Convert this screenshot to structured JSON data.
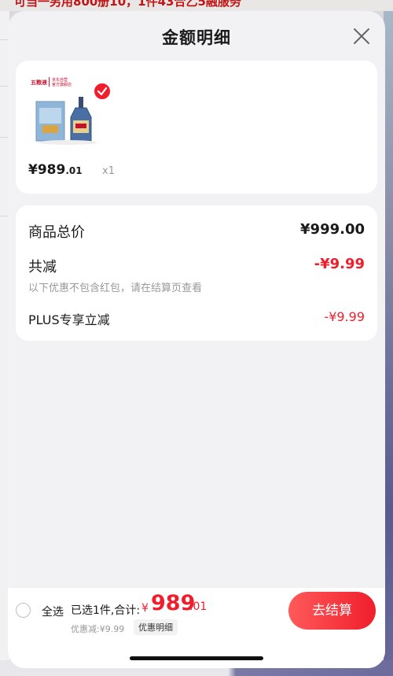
{
  "background": {
    "top_text": "可当一另用800册10，1件43合乙5融服务"
  },
  "sheet": {
    "title": "金额明细",
    "close_icon": "close-icon"
  },
  "product": {
    "store_badge": "京东自营 官方旗舰店",
    "price_int": "¥989",
    "price_cents": ".01",
    "quantity": "x1",
    "selected": true
  },
  "summary": {
    "total_label": "商品总价",
    "total_value": "¥999.00",
    "reduce_label": "共减",
    "reduce_value": "-¥9.99",
    "reduce_note": "以下优惠不包含红包，请在结算页查看",
    "plus_label": "PLUS专享立减",
    "plus_value": "-¥9.99"
  },
  "footer": {
    "select_all_label": "全选",
    "selected_text": "已选1件,合计:",
    "total_currency": "¥",
    "total_int": "989",
    "total_cents": ".01",
    "discount_text": "优惠减:¥9.99",
    "detail_link": "优惠明细",
    "checkout_label": "去结算"
  },
  "colors": {
    "accent": "#f01e2c",
    "sheet_bg": "#f2f2f4",
    "card_bg": "#ffffff"
  }
}
